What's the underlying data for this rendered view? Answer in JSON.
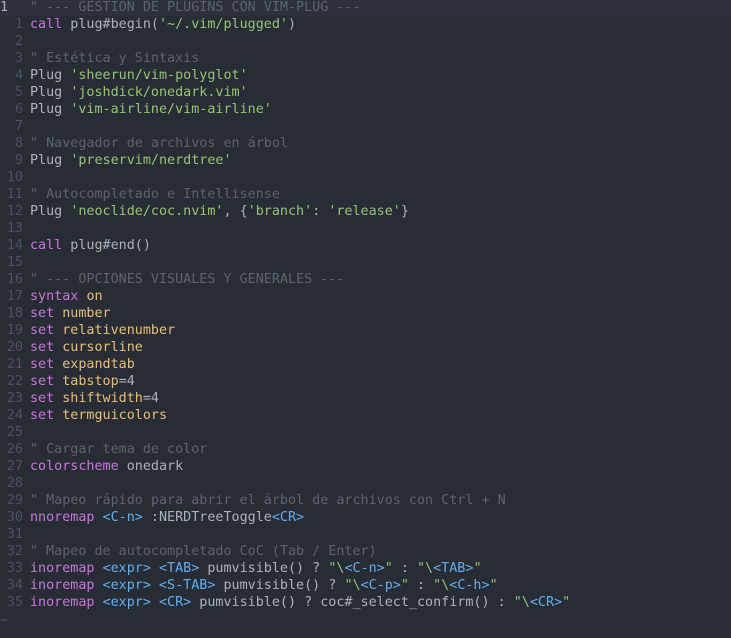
{
  "editor": {
    "theme": {
      "background": "#282c34",
      "keyword": "#c678dd",
      "string": "#98c379",
      "comment": "#5c6370",
      "number": "#d19a66",
      "special_key": "#61afef",
      "line_number": "#4b5263"
    },
    "empty_line_marker": "~",
    "lines": [
      {
        "n": "1",
        "current": true,
        "tokens": [
          [
            "cm",
            "\" --- GESTIÓN DE PLUGINS CON VIM-PLUG ---"
          ]
        ]
      },
      {
        "n": "1",
        "tokens": [
          [
            "kw",
            "call"
          ],
          [
            "pl",
            " plug#begin("
          ],
          [
            "st",
            "'~/.vim/plugged'"
          ],
          [
            "pl",
            ")"
          ]
        ]
      },
      {
        "n": "2",
        "tokens": []
      },
      {
        "n": "3",
        "tokens": [
          [
            "cm",
            "\" Estética y Sintaxis"
          ]
        ]
      },
      {
        "n": "4",
        "tokens": [
          [
            "pl",
            "Plug "
          ],
          [
            "st",
            "'sheerun/vim-polyglot'"
          ]
        ]
      },
      {
        "n": "5",
        "tokens": [
          [
            "pl",
            "Plug "
          ],
          [
            "st",
            "'joshdick/onedark.vim'"
          ]
        ]
      },
      {
        "n": "6",
        "tokens": [
          [
            "pl",
            "Plug "
          ],
          [
            "st",
            "'vim-airline/vim-airline'"
          ]
        ]
      },
      {
        "n": "7",
        "tokens": []
      },
      {
        "n": "8",
        "tokens": [
          [
            "cm",
            "\" Navegador de archivos en árbol"
          ]
        ]
      },
      {
        "n": "9",
        "tokens": [
          [
            "pl",
            "Plug "
          ],
          [
            "st",
            "'preservim/nerdtree'"
          ]
        ]
      },
      {
        "n": "10",
        "tokens": []
      },
      {
        "n": "11",
        "tokens": [
          [
            "cm",
            "\" Autocompletado e Intellisense"
          ]
        ]
      },
      {
        "n": "12",
        "tokens": [
          [
            "pl",
            "Plug "
          ],
          [
            "st",
            "'neoclide/coc.nvim'"
          ],
          [
            "pl",
            ", {"
          ],
          [
            "st",
            "'branch'"
          ],
          [
            "pl",
            ": "
          ],
          [
            "st",
            "'release'"
          ],
          [
            "pl",
            "}"
          ]
        ]
      },
      {
        "n": "13",
        "tokens": []
      },
      {
        "n": "14",
        "tokens": [
          [
            "kw",
            "call"
          ],
          [
            "pl",
            " plug#end()"
          ]
        ]
      },
      {
        "n": "15",
        "tokens": []
      },
      {
        "n": "16",
        "tokens": [
          [
            "cm",
            "\" --- OPCIONES VISUALES Y GENERALES ---"
          ]
        ]
      },
      {
        "n": "17",
        "tokens": [
          [
            "kw",
            "syntax"
          ],
          [
            "pl",
            " "
          ],
          [
            "op",
            "on"
          ]
        ]
      },
      {
        "n": "18",
        "tokens": [
          [
            "kw",
            "set"
          ],
          [
            "pl",
            " "
          ],
          [
            "op",
            "number"
          ]
        ]
      },
      {
        "n": "19",
        "tokens": [
          [
            "kw",
            "set"
          ],
          [
            "pl",
            " "
          ],
          [
            "op",
            "relativenumber"
          ]
        ]
      },
      {
        "n": "20",
        "tokens": [
          [
            "kw",
            "set"
          ],
          [
            "pl",
            " "
          ],
          [
            "op",
            "cursorline"
          ]
        ]
      },
      {
        "n": "21",
        "tokens": [
          [
            "kw",
            "set"
          ],
          [
            "pl",
            " "
          ],
          [
            "op",
            "expandtab"
          ]
        ]
      },
      {
        "n": "22",
        "tokens": [
          [
            "kw",
            "set"
          ],
          [
            "pl",
            " "
          ],
          [
            "op",
            "tabstop"
          ],
          [
            "pl",
            "=4"
          ]
        ]
      },
      {
        "n": "23",
        "tokens": [
          [
            "kw",
            "set"
          ],
          [
            "pl",
            " "
          ],
          [
            "op",
            "shiftwidth"
          ],
          [
            "pl",
            "=4"
          ]
        ]
      },
      {
        "n": "24",
        "tokens": [
          [
            "kw",
            "set"
          ],
          [
            "pl",
            " "
          ],
          [
            "op",
            "termguicolors"
          ]
        ]
      },
      {
        "n": "25",
        "tokens": []
      },
      {
        "n": "26",
        "tokens": [
          [
            "cm",
            "\" Cargar tema de color"
          ]
        ]
      },
      {
        "n": "27",
        "tokens": [
          [
            "kw",
            "colorscheme"
          ],
          [
            "pl",
            " onedark"
          ]
        ]
      },
      {
        "n": "28",
        "tokens": []
      },
      {
        "n": "29",
        "tokens": [
          [
            "cm",
            "\" Mapeo rápido para abrir el árbol de archivos con Ctrl + N"
          ]
        ]
      },
      {
        "n": "30",
        "tokens": [
          [
            "kw",
            "nnoremap"
          ],
          [
            "pl",
            " "
          ],
          [
            "ky",
            "<C-n>"
          ],
          [
            "pl",
            " :NERDTreeToggle"
          ],
          [
            "ky",
            "<CR>"
          ]
        ]
      },
      {
        "n": "31",
        "tokens": []
      },
      {
        "n": "32",
        "tokens": [
          [
            "cm",
            "\" Mapeo de autocompletado CoC (Tab / Enter)"
          ]
        ]
      },
      {
        "n": "33",
        "tokens": [
          [
            "kw",
            "inoremap"
          ],
          [
            "pl",
            " "
          ],
          [
            "ky",
            "<expr>"
          ],
          [
            "pl",
            " "
          ],
          [
            "ky",
            "<TAB>"
          ],
          [
            "pl",
            " pumvisible() ? "
          ],
          [
            "st",
            "\"\\"
          ],
          [
            "ky",
            "<C-n>"
          ],
          [
            "st",
            "\""
          ],
          [
            "pl",
            " : "
          ],
          [
            "st",
            "\"\\"
          ],
          [
            "ky",
            "<TAB>"
          ],
          [
            "st",
            "\""
          ]
        ]
      },
      {
        "n": "34",
        "tokens": [
          [
            "kw",
            "inoremap"
          ],
          [
            "pl",
            " "
          ],
          [
            "ky",
            "<expr>"
          ],
          [
            "pl",
            " "
          ],
          [
            "ky",
            "<S-TAB>"
          ],
          [
            "pl",
            " pumvisible() ? "
          ],
          [
            "st",
            "\"\\"
          ],
          [
            "ky",
            "<C-p>"
          ],
          [
            "st",
            "\""
          ],
          [
            "pl",
            " : "
          ],
          [
            "st",
            "\"\\"
          ],
          [
            "ky",
            "<C-h>"
          ],
          [
            "st",
            "\""
          ]
        ]
      },
      {
        "n": "35",
        "tokens": [
          [
            "kw",
            "inoremap"
          ],
          [
            "pl",
            " "
          ],
          [
            "ky",
            "<expr>"
          ],
          [
            "pl",
            " "
          ],
          [
            "ky",
            "<CR>"
          ],
          [
            "pl",
            " pumvisible() ? coc#_select_confirm() : "
          ],
          [
            "st",
            "\"\\"
          ],
          [
            "ky",
            "<CR>"
          ],
          [
            "st",
            "\""
          ]
        ]
      }
    ]
  }
}
